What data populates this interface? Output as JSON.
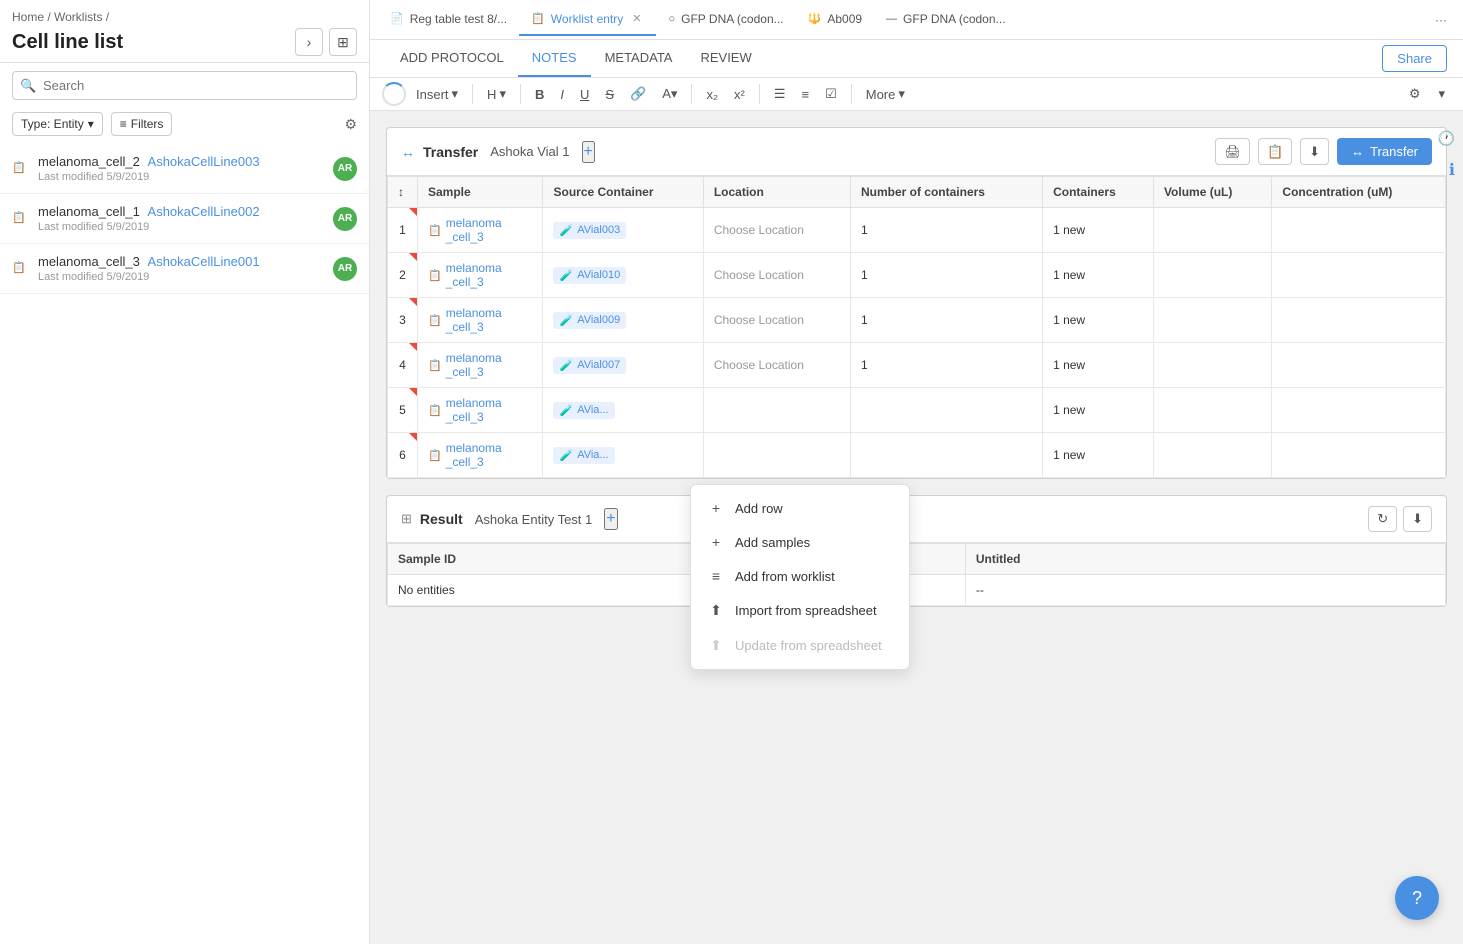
{
  "sidebar": {
    "breadcrumb": "Home / Worklists /",
    "title": "Cell line list",
    "search_placeholder": "Search",
    "filter_type": "Type: Entity",
    "filter_label": "Filters",
    "entities": [
      {
        "name": "melanoma_cell_2",
        "id": "AshokaCellLine003",
        "date": "Last modified 5/9/2019",
        "avatar": "AR"
      },
      {
        "name": "melanoma_cell_1",
        "id": "AshokaCellLine002",
        "date": "Last modified 5/9/2019",
        "avatar": "AR"
      },
      {
        "name": "melanoma_cell_3",
        "id": "AshokaCellLine001",
        "date": "Last modified 5/9/2019",
        "avatar": "AR"
      }
    ]
  },
  "tabs": [
    {
      "label": "Reg table test 8/...",
      "icon": "📄",
      "active": false,
      "closable": false
    },
    {
      "label": "Worklist entry",
      "icon": "📋",
      "active": true,
      "closable": true
    },
    {
      "label": "GFP DNA (codon...",
      "icon": "○",
      "active": false,
      "closable": false
    },
    {
      "label": "Ab009",
      "icon": "🔱",
      "active": false,
      "closable": false
    },
    {
      "label": "GFP DNA (codon...",
      "icon": "—",
      "active": false,
      "closable": false
    }
  ],
  "sub_tabs": [
    "ADD PROTOCOL",
    "NOTES",
    "METADATA",
    "REVIEW"
  ],
  "active_sub_tab": "NOTES",
  "share_label": "Share",
  "toolbar": {
    "insert_label": "Insert",
    "heading_label": "H",
    "more_label": "More"
  },
  "transfer_section": {
    "title": "Transfer",
    "subtitle": "Ashoka Vial 1",
    "transfer_btn": "Transfer",
    "columns": [
      "",
      "Sample",
      "Source Container",
      "Location",
      "Number of containers",
      "Containers",
      "Volume (uL)",
      "Concentration (uM)"
    ],
    "rows": [
      {
        "num": 1,
        "sample": "melanoma_cell_3",
        "source": "AVial003",
        "location": "Choose Location",
        "containers": 1,
        "new_containers": "1 new"
      },
      {
        "num": 2,
        "sample": "melanoma_cell_3",
        "source": "AVial010",
        "location": "Choose Location",
        "containers": 1,
        "new_containers": "1 new"
      },
      {
        "num": 3,
        "sample": "melanoma_cell_3",
        "source": "AVial009",
        "location": "Choose Location",
        "containers": 1,
        "new_containers": "1 new"
      },
      {
        "num": 4,
        "sample": "melanoma_cell_3",
        "source": "AVial007",
        "location": "Choose Location",
        "containers": 1,
        "new_containers": "1 new"
      },
      {
        "num": 5,
        "sample": "melanoma_cell_3",
        "source": "AVia...",
        "location": "",
        "containers": null,
        "new_containers": "1 new"
      },
      {
        "num": 6,
        "sample": "melanoma_cell_3",
        "source": "AVia...",
        "location": "",
        "containers": null,
        "new_containers": "1 new"
      }
    ]
  },
  "dropdown_menu": {
    "items": [
      {
        "label": "Add row",
        "icon": "+",
        "disabled": false
      },
      {
        "label": "Add samples",
        "icon": "+",
        "disabled": false
      },
      {
        "label": "Add from worklist",
        "icon": "≡",
        "disabled": false
      },
      {
        "label": "Import from spreadsheet",
        "icon": "⬆",
        "disabled": false
      },
      {
        "label": "Update from spreadsheet",
        "icon": "⬆",
        "disabled": true
      }
    ]
  },
  "result_section": {
    "title": "Result",
    "subtitle": "Ashoka Entity Test 1",
    "columns": [
      "Sample ID",
      "Untitled"
    ],
    "rows": [
      {
        "sample_id": "No entities",
        "untitled": "--"
      }
    ]
  },
  "fab_label": "?"
}
